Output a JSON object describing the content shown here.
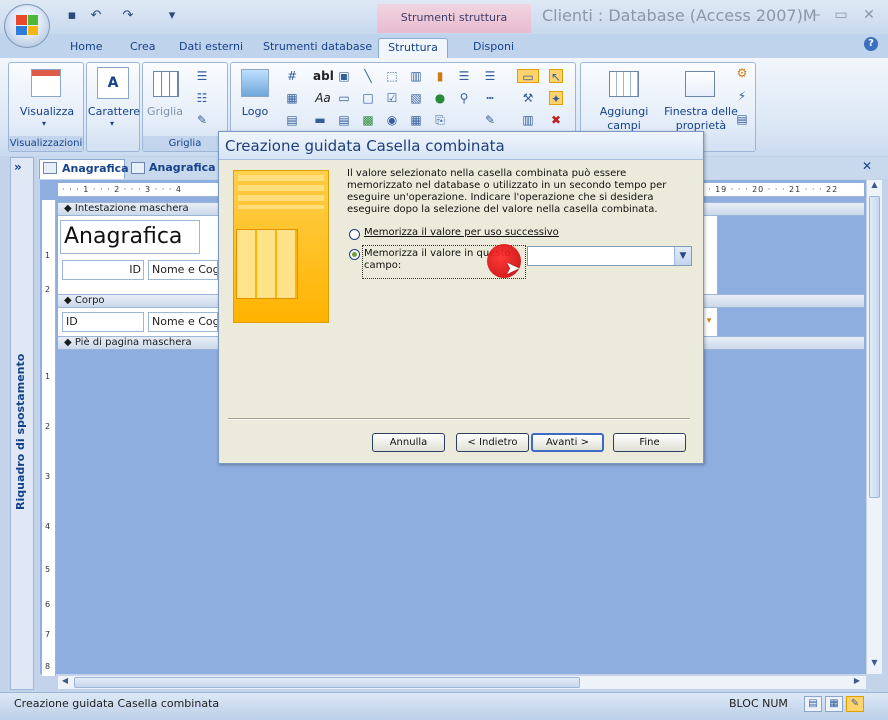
{
  "title_bar": {
    "context_tab_header": "Strumenti struttura maschera",
    "window_title": "Clienti : Database (Access 2007)M",
    "quick_access": [
      "save-icon",
      "undo-icon",
      "redo-icon",
      "customize-icon"
    ],
    "window_controls": [
      "–",
      "▭",
      "✕"
    ]
  },
  "ribbon_tabs": [
    "Home",
    "Crea",
    "Dati esterni",
    "Strumenti database",
    "Struttura",
    "Disponi"
  ],
  "active_tab": "Struttura",
  "ribbon": {
    "groups": [
      {
        "label": "Visualizzazioni",
        "buttons": [
          "Visualizza"
        ]
      },
      {
        "label": "",
        "buttons": [
          "Carattere"
        ]
      },
      {
        "label": "Griglia",
        "buttons": [
          "Griglia"
        ]
      },
      {
        "label": "",
        "buttons": [
          "Logo"
        ]
      },
      {
        "label": "",
        "buttons": [
          "Aggiungi campi esistenti",
          "Finestra delle proprietà"
        ]
      }
    ],
    "visualizza_label": "Visualizza",
    "carattere_label": "Carattere",
    "carattere_glyph": "A",
    "griglia_label": "Griglia",
    "logo_label": "Logo",
    "aggiungi_label_1": "Aggiungi",
    "aggiungi_label_2": "campi esistenti",
    "finestra_label_1": "Finestra delle",
    "finestra_label_2": "proprietà",
    "group_visualizzazioni": "Visualizzazioni",
    "group_griglia": "Griglia",
    "controls_glyph_abl": "abl",
    "controls_glyph_aa": "Aa"
  },
  "doc_tabs": [
    "Anagrafica",
    "Anagrafica"
  ],
  "nav_pane": {
    "title": "Riquadro di spostamento",
    "toggle": "»"
  },
  "ruler": {
    "top_left": "· · · 1 · · · 2 · · · 3 · · · 4",
    "top_right": "· 19 · · · 20 · · · 21 · · · 22",
    "left": [
      "1",
      "2",
      "1",
      "2",
      "3",
      "4",
      "5",
      "6",
      "7",
      "8",
      "9"
    ]
  },
  "form": {
    "header_section": "Intestazione maschera",
    "title_text": "Anagrafica",
    "header_label_id": "ID",
    "header_label_nome": "Nome e Cog",
    "body_section": "Corpo",
    "body_field_id": "ID",
    "body_field_nome": "Nome e Cog",
    "footer_section": "Piè di pagina maschera"
  },
  "dialog": {
    "title": "Creazione guidata Casella combinata",
    "description": "Il valore selezionato nella casella combinata può essere memorizzato nel database o utilizzato in un secondo tempo per eseguire un'operazione. Indicare l'operazione che si desidera eseguire dopo la selezione del valore nella casella combinata.",
    "option_later": "Memorizza il valore per uso successivo",
    "option_store_1": "Memorizza il valore in questo",
    "option_store_2": "campo:",
    "selected_option": "option_store",
    "field_value": "",
    "buttons": {
      "cancel": "Annulla",
      "back": "< Indietro",
      "next": "Avanti >",
      "finish": "Fine"
    }
  },
  "status_bar": {
    "left": "Creazione guidata Casella combinata",
    "right": "BLOC NUM"
  },
  "colors": {
    "accent": "#15428b",
    "context_tab": "#e7bcd0",
    "design_background": "#8eaedf",
    "dialog_background": "#ebeadb",
    "wizard_art": "#ffb300"
  }
}
